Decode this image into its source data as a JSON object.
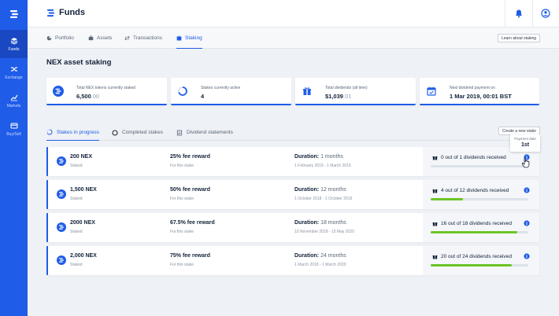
{
  "colors": {
    "brand": "#1f5ce8",
    "progress": "#6cc526"
  },
  "sidebar": {
    "items": [
      {
        "label": "Funds",
        "icon": "layers-icon",
        "active": true
      },
      {
        "label": "Exchange",
        "icon": "shuffle-icon"
      },
      {
        "label": "Markets",
        "icon": "chart-line-icon"
      },
      {
        "label": "Buy/Sell",
        "icon": "credit-card-icon"
      }
    ]
  },
  "header": {
    "title": "Funds"
  },
  "tabs": [
    {
      "label": "Portfolio"
    },
    {
      "label": "Assets"
    },
    {
      "label": "Transactions"
    },
    {
      "label": "Staking"
    }
  ],
  "learn_button": "Learn about staking",
  "page_title": "NEX asset staking",
  "stats": [
    {
      "label": "Total NEX tokens currently staked",
      "value_main": "6,500",
      "value_muted": ".00"
    },
    {
      "label": "Stakes currently active",
      "value_main": "4",
      "value_muted": ""
    },
    {
      "label": "Total dividends (all time)",
      "value_main": "$1,039",
      "value_muted": ".01"
    },
    {
      "label": "Next dividend payment on",
      "value_main": "1 Mar 2019, 00:01 BST",
      "value_muted": ""
    }
  ],
  "subtabs": [
    {
      "label": "Stakes in progress"
    },
    {
      "label": "Completed stakes"
    },
    {
      "label": "Dividend statements"
    }
  ],
  "create_button": "Create a new stake",
  "tooltip": {
    "label": "Payment date",
    "value": "1st"
  },
  "stakes": [
    {
      "amount": "200 NEX",
      "status": "Staked",
      "reward": "25% fee reward",
      "reward_sub": "For this stake",
      "duration_label": "Duration:",
      "duration_value": "1 months",
      "dates": "1 February 2019 - 1 March 2019",
      "dividends": "0 out of 1 dividends received",
      "progress": 0.0
    },
    {
      "amount": "1,500 NEX",
      "status": "Staked",
      "reward": "50% fee reward",
      "reward_sub": "For this stake",
      "duration_label": "Duration:",
      "duration_value": "12 months",
      "dates": "1 October 2018 - 1 October 2019",
      "dividends": "4 out of 12 dividends received",
      "progress": 0.33
    },
    {
      "amount": "2000 NEX",
      "status": "Staked",
      "reward": "67.5% fee reward",
      "reward_sub": "For this stake",
      "duration_label": "Duration:",
      "duration_value": "18 months",
      "dates": "10 November 2018 - 10 May 2020",
      "dividends": "16 out of 18 dividends received",
      "progress": 0.89
    },
    {
      "amount": "2,000 NEX",
      "status": "Staked",
      "reward": "75% fee reward",
      "reward_sub": "For this stake",
      "duration_label": "Duration:",
      "duration_value": "24 months",
      "dates": "1 March 2018 - 1 March 2020",
      "dividends": "20 out of 24 dividends received",
      "progress": 0.83
    }
  ]
}
